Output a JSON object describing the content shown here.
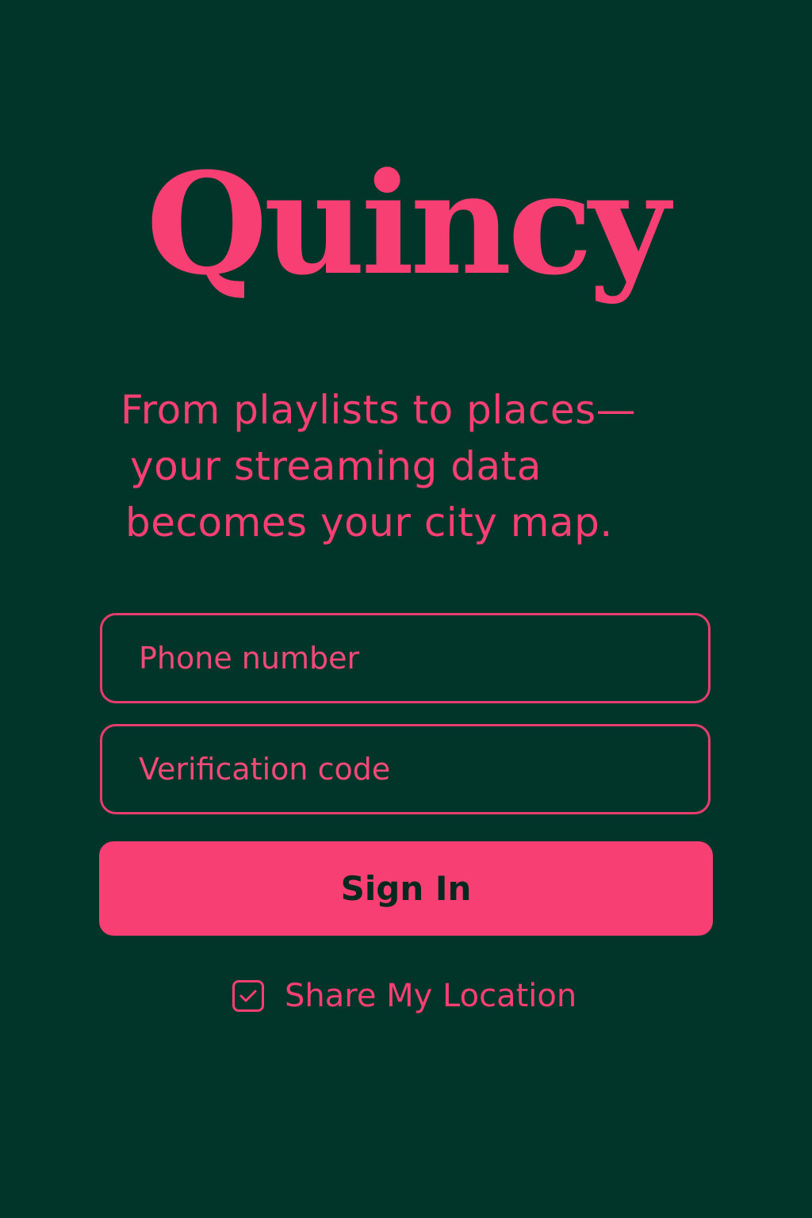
{
  "app": {
    "name": "Quincy"
  },
  "tagline": {
    "line1": "From playlists to places—",
    "line2": "your streaming data",
    "line3": "becomes your city map."
  },
  "form": {
    "phone_placeholder": "Phone number",
    "phone_value": "",
    "code_placeholder": "Verification code",
    "code_value": "",
    "sign_in_label": "Sign In",
    "share_location_label": "Share My Location",
    "share_location_checked": true
  },
  "colors": {
    "background": "#01352a",
    "accent": "#f73f73",
    "button_text": "#06291f"
  },
  "icons": {
    "checkbox": "checkbox-checked-icon"
  }
}
